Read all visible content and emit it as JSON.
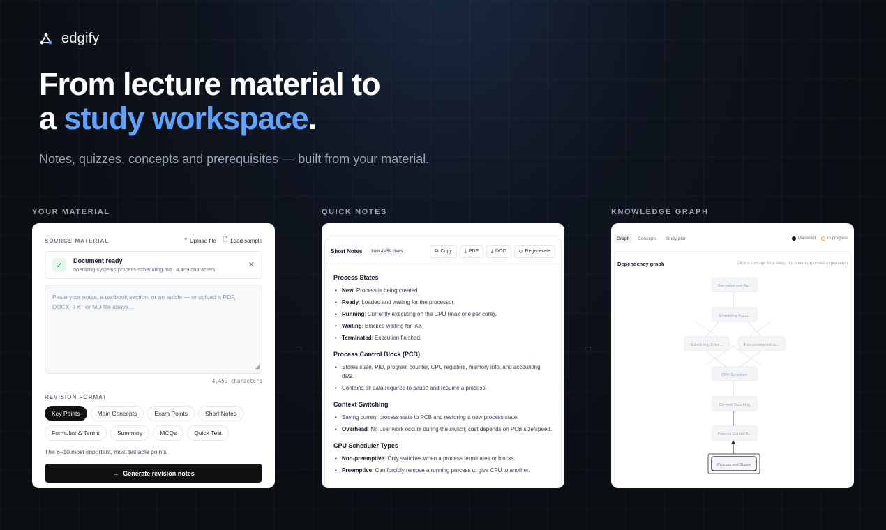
{
  "brand": {
    "name": "edgify",
    "logo_icon": "triangle-nodes-icon"
  },
  "hero": {
    "title_line1": "From lecture material to",
    "title_line2_prefix": "a ",
    "title_line2_accent": "study workspace",
    "title_line2_suffix": ".",
    "subtitle": "Notes, quizzes, concepts and prerequisites — built from your material.",
    "accent_color": "#5ea3ff"
  },
  "columns": {
    "material": "YOUR MATERIAL",
    "notes": "QUICK NOTES",
    "graph": "KNOWLEDGE GRAPH",
    "arrow": "→"
  },
  "material": {
    "source_label": "SOURCE MATERIAL",
    "upload_label": "Upload file",
    "sample_label": "Load sample",
    "doc_status": "Document ready",
    "doc_meta": "operating-systems-process-scheduling.md · 4,459 characters",
    "placeholder": "Paste your notes, a textbook section, or an article — or upload a PDF, DOCX, TXT or MD file above…",
    "char_count": "4,459 characters",
    "format_label": "REVISION FORMAT",
    "formats": [
      "Key Points",
      "Main Concepts",
      "Exam Points",
      "Short Notes",
      "Formulas & Terms",
      "Summary",
      "MCQs",
      "Quick Test"
    ],
    "active_format": "Key Points",
    "format_desc": "The 6–10 most important, most testable points.",
    "generate_label": "Generate revision notes"
  },
  "notes": {
    "title": "Short Notes",
    "badge": "from 4,459 chars",
    "actions": {
      "copy": "Copy",
      "pdf": "PDF",
      "doc": "DOC",
      "regen": "Regenerate"
    },
    "s1_title": "Process States",
    "s1": [
      {
        "term": "New",
        "text": ": Process is being created."
      },
      {
        "term": "Ready",
        "text": ": Loaded and waiting for the processor."
      },
      {
        "term": "Running",
        "text": ": Currently executing on the CPU (max one per core)."
      },
      {
        "term": "Waiting",
        "text": ": Blocked waiting for I/O."
      },
      {
        "term": "Terminated",
        "text": ": Execution finished."
      }
    ],
    "s2_title": "Process Control Block (PCB)",
    "s2": [
      "Stores state, PID, program counter, CPU registers, memory info, and accounting data.",
      "Contains all data required to pause and resume a process."
    ],
    "s3_title": "Context Switching",
    "s3_item1": "Saving current process state to PCB and restoring a new process state.",
    "s3_item2_term": "Overhead",
    "s3_item2_text": ": No user work occurs during the switch; cost depends on PCB size/speed.",
    "s4_title": "CPU Scheduler Types",
    "s4": [
      {
        "term": "Non-preemptive",
        "text": ": Only switches when a process terminates or blocks."
      },
      {
        "term": "Preemptive",
        "text": ": Can forcibly remove a running process to give CPU to another."
      }
    ]
  },
  "graph": {
    "tabs": [
      "Graph",
      "Concepts",
      "Study plan"
    ],
    "active_tab": "Graph",
    "legend": [
      {
        "label": "Mastered",
        "color": "#111111"
      },
      {
        "label": "In progress",
        "color": "#f59e0b"
      }
    ],
    "title": "Dependency graph",
    "hint": "Click a concept for a deep, document-grounded explanation",
    "nodes": {
      "n1": "Starvation and Ag...",
      "n2": "Scheduling Algori...",
      "n3": "Scheduling Criter...",
      "n4": "Non-preemptive vs...",
      "n5": "CPU Scheduler",
      "n6": "Context Switching",
      "n7": "Process Control B...",
      "n8": "Process and States"
    }
  }
}
